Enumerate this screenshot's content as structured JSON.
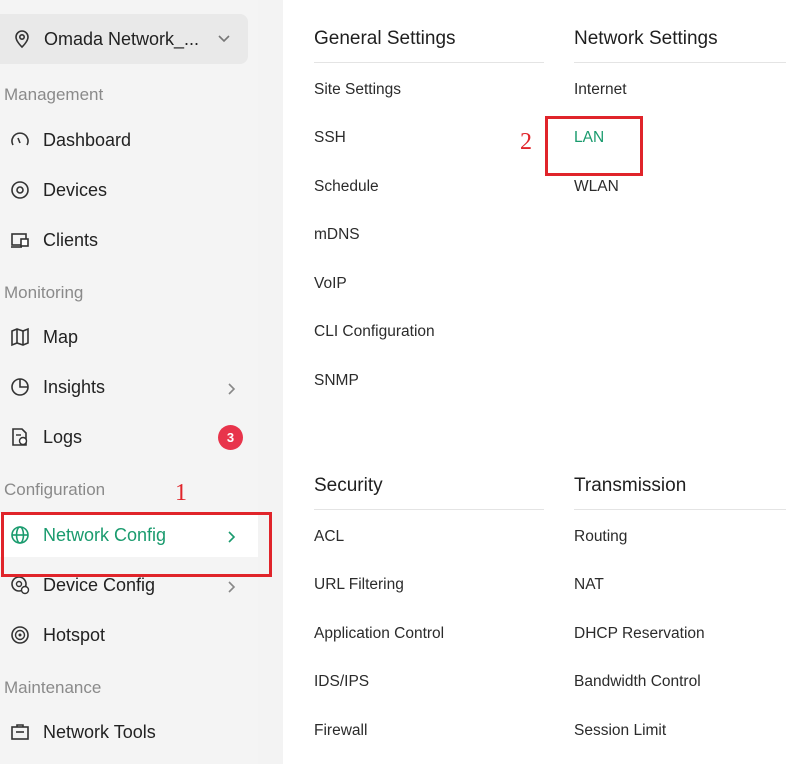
{
  "sidebar": {
    "site_name": "Omada Network_...",
    "sections": {
      "management": "Management",
      "monitoring": "Monitoring",
      "configuration": "Configuration",
      "maintenance": "Maintenance"
    },
    "items": {
      "dashboard": "Dashboard",
      "devices": "Devices",
      "clients": "Clients",
      "map": "Map",
      "insights": "Insights",
      "logs": "Logs",
      "logs_badge": "3",
      "network_config": "Network Config",
      "device_config": "Device Config",
      "hotspot": "Hotspot",
      "network_tools": "Network Tools"
    }
  },
  "panel": {
    "general": {
      "title": "General Settings",
      "links": [
        "Site Settings",
        "SSH",
        "Schedule",
        "mDNS",
        "VoIP",
        "CLI Configuration",
        "SNMP"
      ]
    },
    "network": {
      "title": "Network Settings",
      "links": [
        "Internet",
        "LAN",
        "WLAN"
      ],
      "active": "LAN"
    },
    "security": {
      "title": "Security",
      "links": [
        "ACL",
        "URL Filtering",
        "Application Control",
        "IDS/IPS",
        "Firewall"
      ]
    },
    "transmission": {
      "title": "Transmission",
      "links": [
        "Routing",
        "NAT",
        "DHCP Reservation",
        "Bandwidth Control",
        "Session Limit"
      ]
    }
  },
  "annotations": {
    "step1": "1",
    "step2": "2"
  },
  "colors": {
    "accent": "#1a9b6e",
    "annotation": "#e0242a",
    "badge": "#e8344b"
  }
}
